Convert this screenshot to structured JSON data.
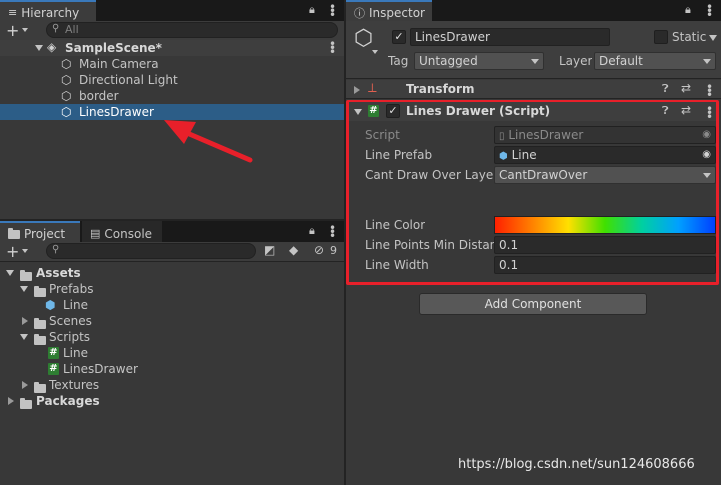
{
  "hierarchy": {
    "tab_label": "Hierarchy",
    "add_label": "+",
    "search_placeholder": "All",
    "scene_name": "SampleScene*",
    "items": [
      {
        "label": "Main Camera"
      },
      {
        "label": "Directional Light"
      },
      {
        "label": "border"
      },
      {
        "label": "LinesDrawer"
      }
    ]
  },
  "project": {
    "tabs": [
      {
        "label": "Project"
      },
      {
        "label": "Console"
      }
    ],
    "add_label": "+",
    "hidden_count": "9",
    "tree": [
      {
        "label": "Assets",
        "kind": "folder-open",
        "depth": 0,
        "bold": true
      },
      {
        "label": "Prefabs",
        "kind": "folder-open",
        "depth": 1
      },
      {
        "label": "Line",
        "kind": "prefab",
        "depth": 2
      },
      {
        "label": "Scenes",
        "kind": "folder",
        "depth": 1
      },
      {
        "label": "Scripts",
        "kind": "folder-open",
        "depth": 1
      },
      {
        "label": "Line",
        "kind": "script",
        "depth": 2
      },
      {
        "label": "LinesDrawer",
        "kind": "script",
        "depth": 2
      },
      {
        "label": "Textures",
        "kind": "folder",
        "depth": 1
      },
      {
        "label": "Packages",
        "kind": "folder",
        "depth": 0,
        "bold": true
      }
    ]
  },
  "inspector": {
    "tab_label": "Inspector",
    "object_name": "LinesDrawer",
    "static_label": "Static",
    "tag_label": "Tag",
    "tag_value": "Untagged",
    "layer_label": "Layer",
    "layer_value": "Default",
    "transform_label": "Transform",
    "component_title": "Lines Drawer (Script)",
    "fields": {
      "script_label": "Script",
      "script_value": "LinesDrawer",
      "line_prefab_label": "Line Prefab",
      "line_prefab_value": "Line",
      "cant_draw_label": "Cant Draw Over Layer",
      "cant_draw_value": "CantDrawOver",
      "line_color_label": "Line Color",
      "min_distance_label": "Line Points Min Distanc",
      "min_distance_value": "0.1",
      "line_width_label": "Line Width",
      "line_width_value": "0.1"
    },
    "add_component_label": "Add Component"
  },
  "watermark": "https://blog.csdn.net/sun124608666",
  "colors": {
    "highlight": "#e8202a",
    "selection": "#2c5d87",
    "arrow": "#e8202a",
    "tab_accent": "#3a79bb"
  }
}
